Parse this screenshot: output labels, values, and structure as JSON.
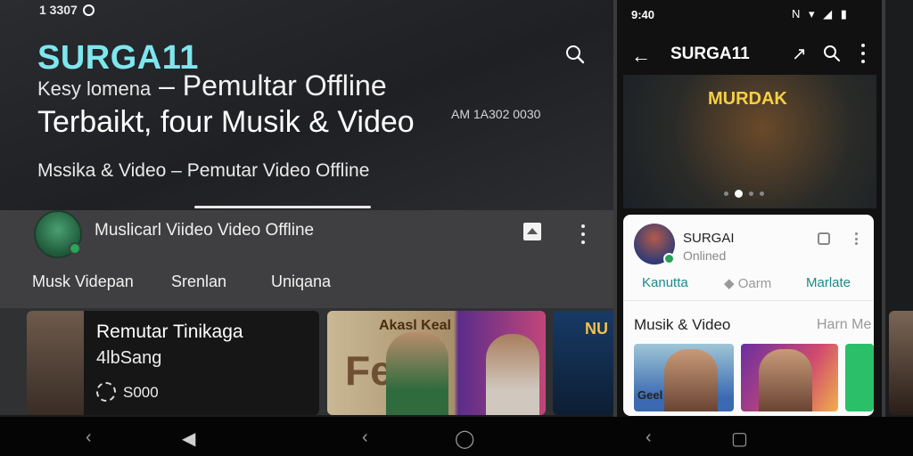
{
  "left": {
    "status_time": "1 3307",
    "brand": "SURGA11",
    "headline_line1_prefix": "Kesy lomena",
    "headline_line1_main": "– Pemultar Offline",
    "headline_line2": "Terbaikt, four Musik & Video",
    "side_code": "AM 1A302 0030",
    "subheading": "Mssika & Video – Pemutar Video Offline",
    "channel_name": "Muslicarl Viideo Video Offline",
    "tabs": [
      "Musk Videpan",
      "Srenlan",
      "Uniqana"
    ],
    "cards": {
      "featured_title": "Remutar Tinikaga",
      "featured_sub": "4lbSang",
      "featured_count": "S000",
      "card2_top": "Akasl Keal",
      "card2_big": "Feal",
      "card3_label": "NU"
    }
  },
  "phone": {
    "status_time": "9:40",
    "status_icons": "N ▾ ◢ ▮",
    "title": "SURGA11",
    "banner_title": "MURDAK",
    "profile_name": "SURGAI",
    "profile_status": "Onlined",
    "actions": [
      "Kanutta",
      "Oarm",
      "Marlate"
    ],
    "section_title": "Musik & Video",
    "section_more": "Harn Me",
    "thumb1_label": "Geel"
  },
  "nav": {
    "back": "‹",
    "home": "◯",
    "recent": "▢",
    "play": "◀"
  },
  "colors": {
    "brand": "#7fe6ee",
    "accent_teal": "#1b8a8a",
    "check_green": "#26a65b"
  }
}
